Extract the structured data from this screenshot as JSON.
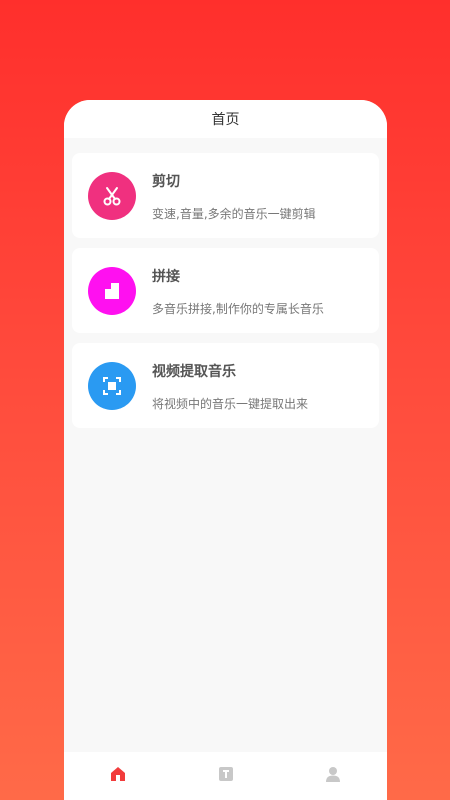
{
  "header": {
    "title": "首页"
  },
  "cards": [
    {
      "title": "剪切",
      "description": "变速,音量,多余的音乐一键剪辑",
      "icon": "scissors-icon",
      "color": "#f0307f"
    },
    {
      "title": "拼接",
      "description": "多音乐拼接,制作你的专属长音乐",
      "icon": "merge-blocks-icon",
      "color": "#ff10f0"
    },
    {
      "title": "视频提取音乐",
      "description": "将视频中的音乐一键提取出来",
      "icon": "extract-frame-icon",
      "color": "#2a9af2"
    }
  ],
  "tabbar": {
    "tabs": [
      {
        "icon": "home-icon",
        "active": true,
        "color": "#f23c3c"
      },
      {
        "icon": "works-icon",
        "active": false,
        "color": "#c8c8c8"
      },
      {
        "icon": "profile-icon",
        "active": false,
        "color": "#c8c8c8"
      }
    ]
  },
  "colors": {
    "background_top": "#ff2f2c",
    "background_bottom": "#ff6a48",
    "accent": "#f23c3c"
  }
}
